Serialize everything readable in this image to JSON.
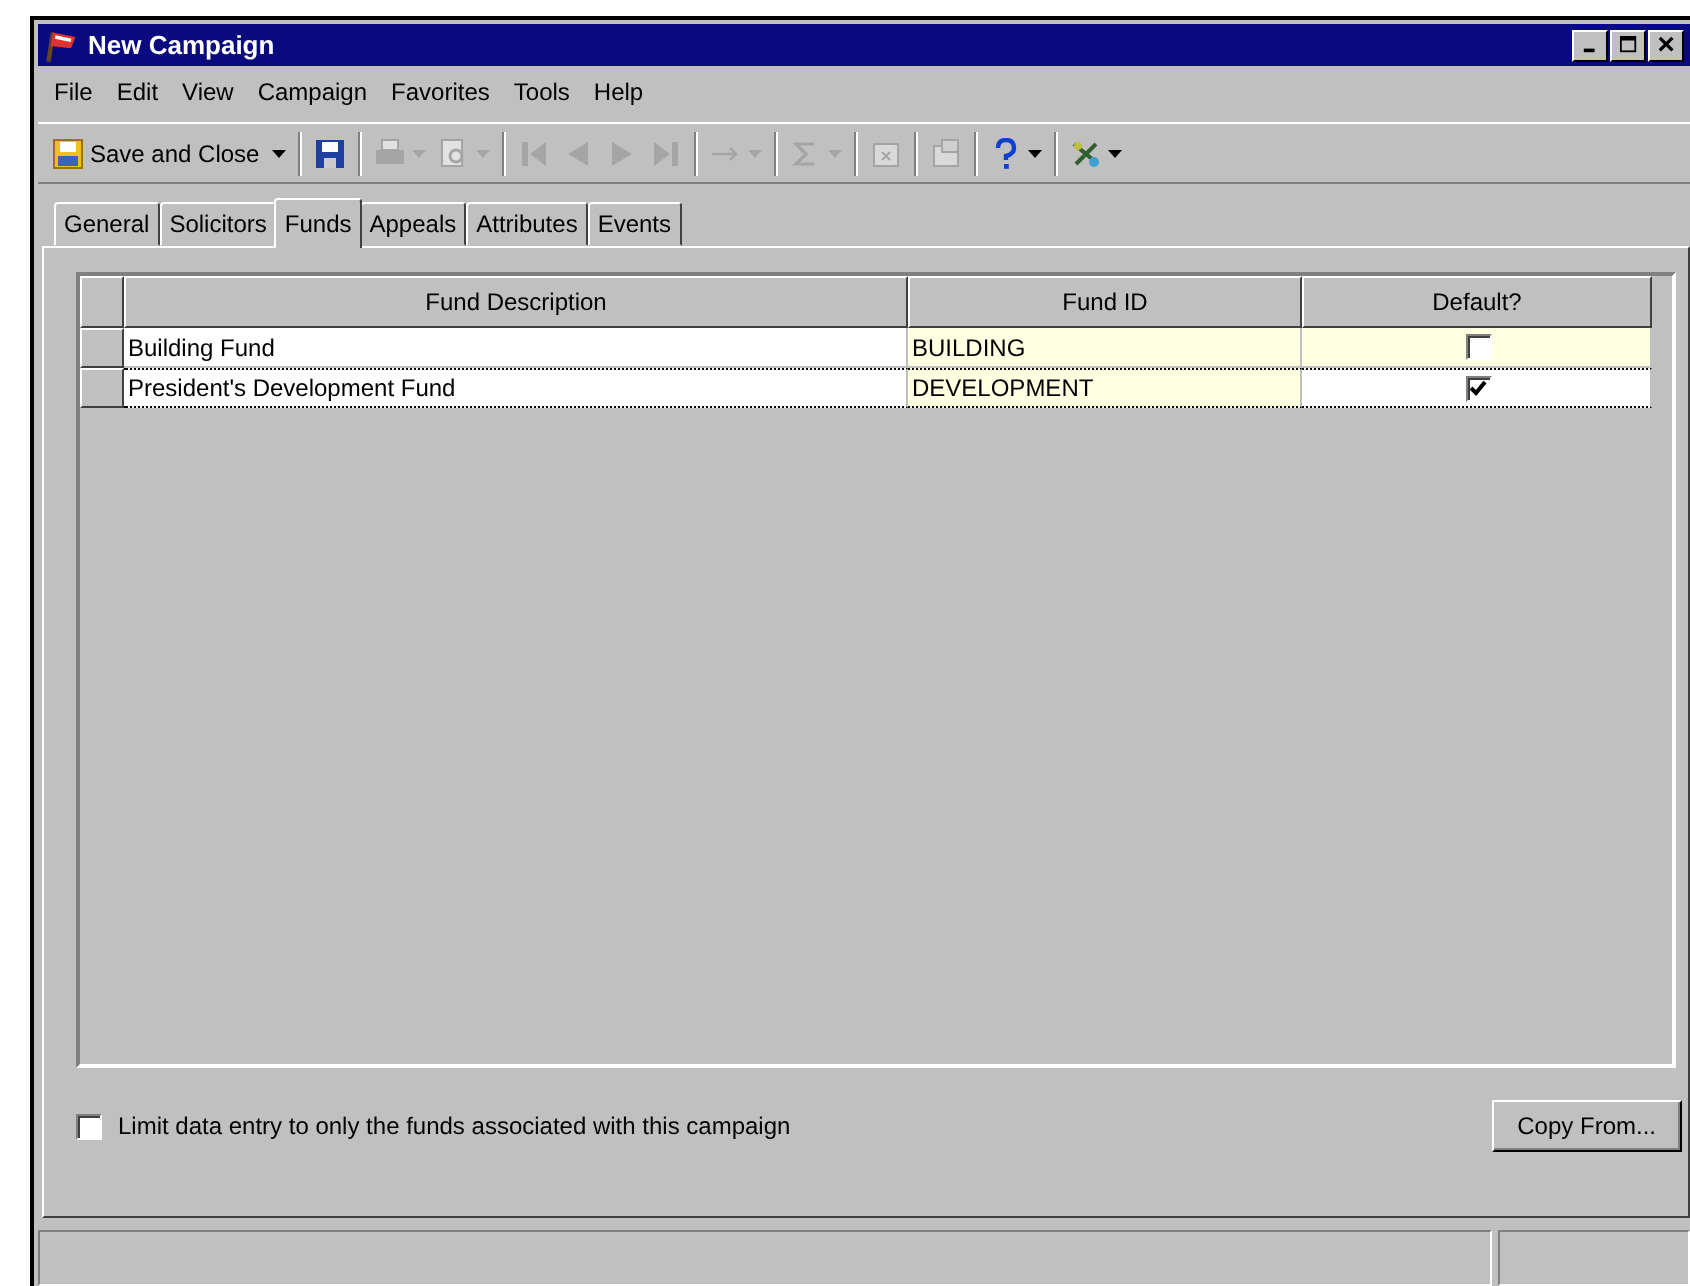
{
  "window": {
    "title": "New Campaign"
  },
  "menu": [
    "File",
    "Edit",
    "View",
    "Campaign",
    "Favorites",
    "Tools",
    "Help"
  ],
  "toolbar": [
    {
      "kind": "save-close",
      "label": "Save and Close",
      "disabled": false
    },
    {
      "kind": "save",
      "disabled": false
    },
    {
      "kind": "print",
      "disabled": true
    },
    {
      "kind": "preview",
      "disabled": true
    },
    {
      "kind": "first",
      "disabled": true
    },
    {
      "kind": "prev",
      "disabled": true
    },
    {
      "kind": "next",
      "disabled": true
    },
    {
      "kind": "last",
      "disabled": true
    },
    {
      "kind": "goto",
      "disabled": true
    },
    {
      "kind": "sum",
      "disabled": true
    },
    {
      "kind": "delete",
      "disabled": true
    },
    {
      "kind": "props",
      "disabled": true
    },
    {
      "kind": "help",
      "disabled": false
    },
    {
      "kind": "tools",
      "disabled": false
    }
  ],
  "tabs": [
    {
      "label": "General",
      "selected": false
    },
    {
      "label": "Solicitors",
      "selected": false
    },
    {
      "label": "Funds",
      "selected": true
    },
    {
      "label": "Appeals",
      "selected": false
    },
    {
      "label": "Attributes",
      "selected": false
    },
    {
      "label": "Events",
      "selected": false
    }
  ],
  "table": {
    "columns": [
      "Fund Description",
      "Fund ID",
      "Default?"
    ],
    "rows": [
      {
        "description": "Building Fund",
        "fund_id": "BUILDING",
        "default": false,
        "selected": false
      },
      {
        "description": "President's Development Fund",
        "fund_id": "DEVELOPMENT",
        "default": true,
        "selected": true
      }
    ]
  },
  "limit_checkbox": {
    "label": "Limit data entry to only the funds associated with this campaign",
    "checked": false
  },
  "copy_button": "Copy From..."
}
